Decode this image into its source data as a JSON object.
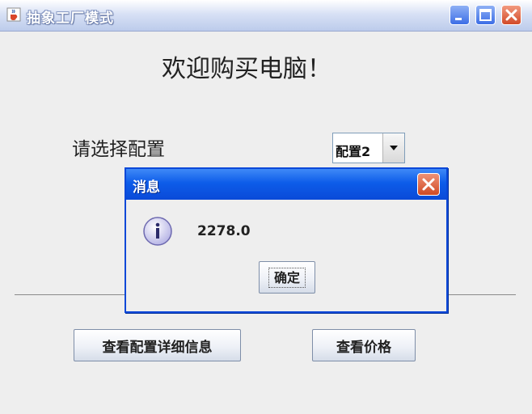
{
  "window": {
    "title": "抽象工厂模式",
    "icon": "java-cup-icon",
    "controls": [
      "minimize-icon",
      "maximize-icon",
      "close-icon"
    ]
  },
  "main": {
    "welcome_text": "欢迎购买电脑！",
    "config_label": "请选择配置",
    "config_select": {
      "value": "配置2",
      "icon": "chevron-down-icon"
    },
    "buttons": {
      "details": "查看配置详细信息",
      "price": "查看价格"
    }
  },
  "dialog": {
    "title": "消息",
    "icon": "info-icon",
    "message": "2278.0",
    "ok_label": "确定"
  },
  "colors": {
    "dialog_title_bar": "#0d5ce9",
    "window_background": "#eeeeee",
    "close_button": "#d04a25"
  }
}
